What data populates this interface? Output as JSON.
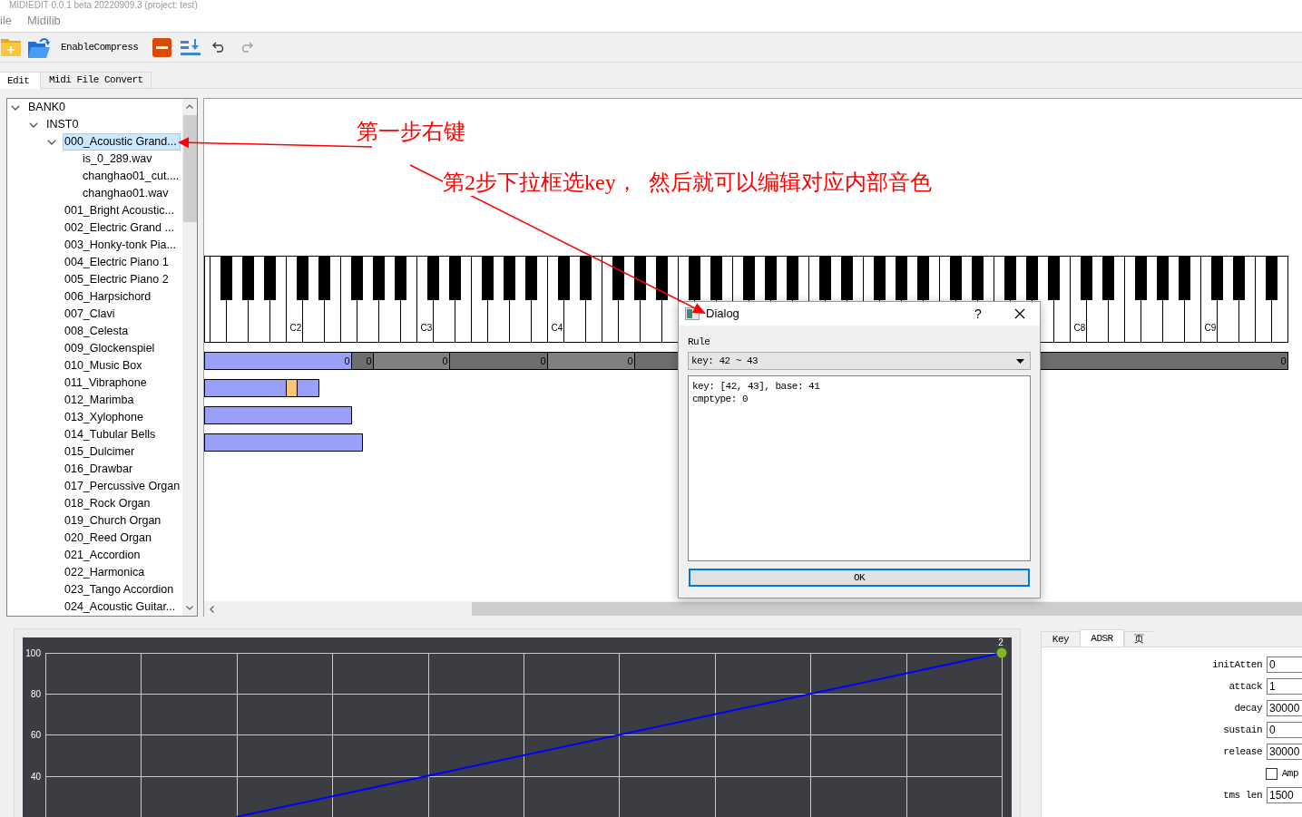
{
  "window": {
    "title": "MIDIEDIT 0.0.1 beta 20220909.3 (project: test)"
  },
  "menu": [
    "ile",
    "Midilib"
  ],
  "toolbar": {
    "compress_label": "EnableCompress",
    "undo": {
      "disabled": false
    },
    "redo": {
      "disabled": true
    }
  },
  "tabs": [
    {
      "label": "Edit",
      "selected": true
    },
    {
      "label": "Midi File Convert",
      "selected": false
    }
  ],
  "tree": [
    {
      "label": "BANK0",
      "expanded": true,
      "selected": false,
      "children": [
        {
          "label": "INST0",
          "expanded": true,
          "selected": false,
          "children": [
            {
              "label": "000_Acoustic Grand...",
              "expanded": true,
              "selected": true,
              "children": [
                {
                  "label": "is_0_289.wav",
                  "selected": false
                },
                {
                  "label": "changhao01_cut....",
                  "selected": false
                },
                {
                  "label": "changhao01.wav",
                  "selected": false
                }
              ]
            },
            {
              "label": "001_Bright Acoustic...",
              "selected": false
            },
            {
              "label": "002_Electric Grand ...",
              "selected": false
            },
            {
              "label": "003_Honky-tonk Pia...",
              "selected": false
            },
            {
              "label": "004_Electric Piano 1",
              "selected": false
            },
            {
              "label": "005_Electric Piano 2",
              "selected": false
            },
            {
              "label": "006_Harpsichord",
              "selected": false
            },
            {
              "label": "007_Clavi",
              "selected": false
            },
            {
              "label": "008_Celesta",
              "selected": false
            },
            {
              "label": "009_Glockenspiel",
              "selected": false
            },
            {
              "label": "010_Music Box",
              "selected": false
            },
            {
              "label": "011_Vibraphone",
              "selected": false
            },
            {
              "label": "012_Marimba",
              "selected": false
            },
            {
              "label": "013_Xylophone",
              "selected": false
            },
            {
              "label": "014_Tubular Bells",
              "selected": false
            },
            {
              "label": "015_Dulcimer",
              "selected": false
            },
            {
              "label": "016_Drawbar",
              "selected": false
            },
            {
              "label": "017_Percussive Organ",
              "selected": false
            },
            {
              "label": "018_Rock Organ",
              "selected": false
            },
            {
              "label": "019_Church Organ",
              "selected": false
            },
            {
              "label": "020_Reed Organ",
              "selected": false
            },
            {
              "label": "021_Accordion",
              "selected": false
            },
            {
              "label": "022_Harmonica",
              "selected": false
            },
            {
              "label": "023_Tango Accordion",
              "selected": false
            },
            {
              "label": "024_Acoustic Guitar...",
              "selected": false
            }
          ]
        }
      ]
    }
  ],
  "piano": {
    "octave_labels": [
      "C2",
      "C3",
      "C4",
      "C8",
      "C9"
    ]
  },
  "key_segments": [
    {
      "value": "0",
      "selected": true
    },
    {
      "value": "0",
      "selected": false
    },
    {
      "value": "0",
      "selected": false
    },
    {
      "value": "0",
      "selected": false
    },
    {
      "value": "0",
      "selected": false
    },
    {
      "selected": false
    },
    {
      "value": "0",
      "selected": false
    }
  ],
  "sample_rows": [
    {
      "root_marker": true
    },
    {
      "root_marker": false
    },
    {
      "root_marker": false
    }
  ],
  "annotations": [
    {
      "text": "第一步右键"
    },
    {
      "text": "第2步下拉框选key，  然后就可以编辑对应内部音色"
    }
  ],
  "dialog": {
    "title": "Dialog",
    "help": "?",
    "rule_label": "Rule",
    "rule_value": "key: 42 ~ 43",
    "details": [
      "key: [42, 43], base: 41",
      "cmptype: 0"
    ],
    "ok": "OK"
  },
  "envelope_chart": {
    "y_labels": [
      "100",
      "80",
      "60",
      "40"
    ],
    "point_label": "2"
  },
  "side_tabs": [
    {
      "label": "Key",
      "selected": false
    },
    {
      "label": "ADSR",
      "selected": true
    },
    {
      "label": "页",
      "selected": false
    }
  ],
  "adsr_fields": [
    {
      "kind": "input",
      "label": "initAtten",
      "value": "0"
    },
    {
      "kind": "input",
      "label": "attack",
      "value": "1"
    },
    {
      "kind": "input",
      "label": "decay",
      "value": "30000"
    },
    {
      "kind": "input",
      "label": "sustain",
      "value": "0"
    },
    {
      "kind": "input",
      "label": "release",
      "value": "30000"
    },
    {
      "kind": "checkbox",
      "label": "Amp",
      "checked": false
    },
    {
      "kind": "input",
      "label": "tms len",
      "value": "1500"
    }
  ]
}
